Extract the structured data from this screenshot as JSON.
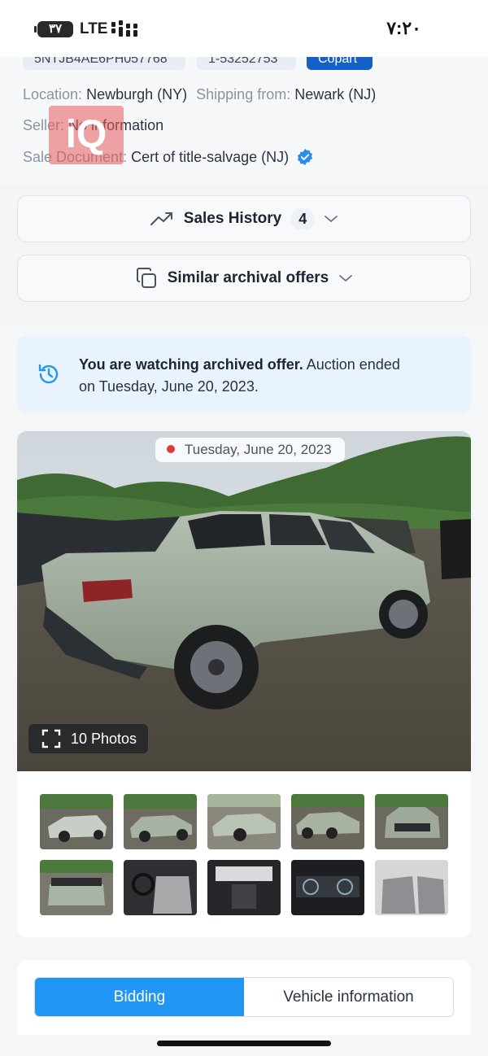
{
  "status_bar": {
    "battery": "۳۷",
    "network": "LTE",
    "time": "۷:۲۰"
  },
  "vehicle": {
    "vin_chip": "5NTJB4AE6PH057768",
    "lot_chip": "1-53252753",
    "auction_chip": "Copart",
    "location_label": "Location:",
    "location_value": "Newburgh (NY)",
    "shipping_label": "Shipping from:",
    "shipping_value": "Newark (NJ)",
    "seller_label": "Seller:",
    "seller_value": "No information",
    "sale_doc_label": "Sale Document:",
    "sale_doc_value": "Cert of title-salvage (NJ)",
    "watermark": "iQ"
  },
  "sales_history": {
    "label": "Sales History",
    "count": "4"
  },
  "similar_offers": {
    "label": "Similar archival offers"
  },
  "notice": {
    "bold": "You are watching archived offer.",
    "rest": " Auction ended on Tuesday, June 20, 2023."
  },
  "gallery": {
    "date": "Tuesday, June 20, 2023",
    "photos_button": "10 Photos",
    "thumbnails": [
      "front-left-damage",
      "front-right",
      "rear-right",
      "side-right",
      "front",
      "rear",
      "interior-driver",
      "dashboard",
      "instrument-cluster",
      "rear-seats"
    ]
  },
  "tabs": {
    "bidding": "Bidding",
    "vehicle_info": "Vehicle information"
  },
  "colors": {
    "accent": "#2196f3",
    "copart": "#1560c8",
    "notice_bg": "#e8f3fd",
    "car": "#9aa898"
  }
}
